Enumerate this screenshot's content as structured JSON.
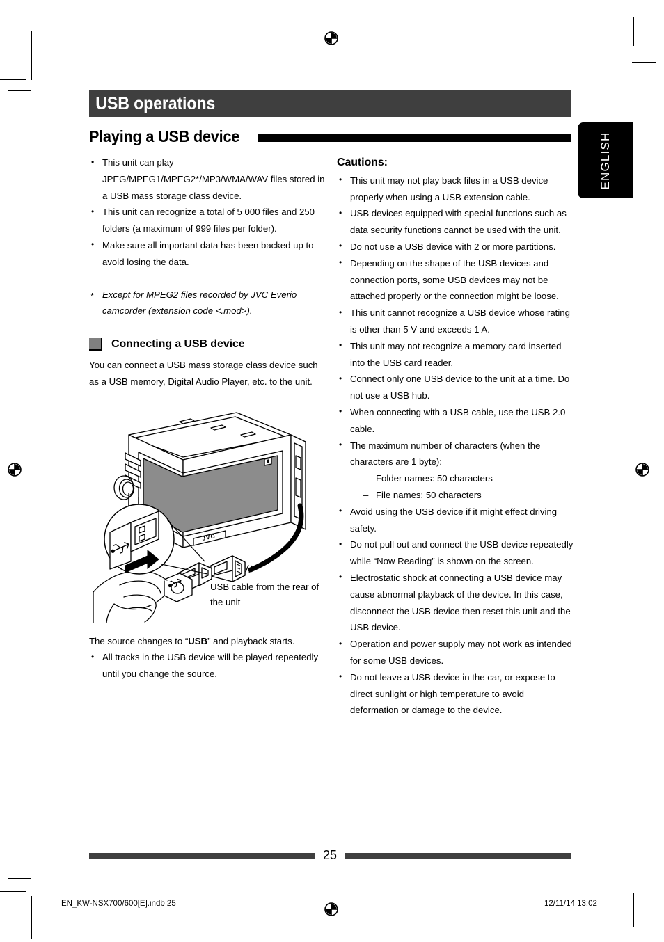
{
  "chapter": {
    "title": "USB operations"
  },
  "section": {
    "title": "Playing a USB device"
  },
  "lang_tab": {
    "label": "ENGLISH"
  },
  "left_column": {
    "intro_bullets": [
      "This unit can play JPEG/MPEG1/MPEG2*/MP3/WMA/WAV files stored in a USB mass storage class device.",
      "This unit can recognize a total of 5 000 files and 250 folders (a maximum of 999 files per folder).",
      "Make sure all important data has been backed up to avoid losing the data."
    ],
    "footnote_marker": "*",
    "footnote": "Except for MPEG2 files recorded by JVC Everio camcorder (extension code <.mod>).",
    "sub_heading": "Connecting a USB device",
    "paragraph": "You can connect a USB mass storage class device such as a USB memory, Digital Audio Player, etc. to the unit.",
    "diagram": {
      "brand_label": "JVC",
      "caption": "USB cable from the rear of the unit"
    },
    "source_line_before": "The source changes to “",
    "source_line_bold": "USB",
    "source_line_after": "” and playback starts.",
    "after_bullets": [
      "All tracks in the USB device will be played repeatedly until you change the source."
    ]
  },
  "right_column": {
    "cautions_heading": "Cautions:",
    "cautions": [
      "This unit may not play back files in a USB device properly when using a USB extension cable.",
      "USB devices equipped with special functions such as data security functions cannot be used with the unit.",
      "Do not use a USB device with 2 or more partitions.",
      "Depending on the shape of the USB devices and connection ports, some USB devices may not be attached properly or the connection might be loose.",
      "This unit cannot recognize a USB device whose rating is other than 5 V and exceeds 1 A.",
      "This unit may not recognize a memory card inserted into the USB card reader.",
      "Connect only one USB device to the unit at a time. Do not use a USB hub.",
      "When connecting with a USB cable, use the USB 2.0 cable.",
      "The maximum number of characters (when the characters are 1 byte):",
      "Avoid using the USB device if it might effect driving safety.",
      "Do not pull out and connect the USB device repeatedly while “Now Reading” is shown on the screen.",
      "Electrostatic shock at connecting a USB device may cause abnormal playback of the device. In this case, disconnect the USB device then reset this unit and the USB device.",
      "Operation and power supply may not work as intended for some USB devices.",
      "Do not leave a USB device in the car, or expose to direct sunlight or high temperature to avoid deformation or damage to the device."
    ],
    "char_limits": [
      "Folder names: 50 characters",
      "File names: 50 characters"
    ]
  },
  "footer": {
    "page_number": "25",
    "file_name": "EN_KW-NSX700/600[E].indb   25",
    "timestamp": "12/11/14   13:02"
  },
  "colors": {
    "banner_gray": "#3f3f3f",
    "rule_black": "#000000",
    "square_gray": "#808080",
    "screen_gray": "#8c8c8c"
  }
}
